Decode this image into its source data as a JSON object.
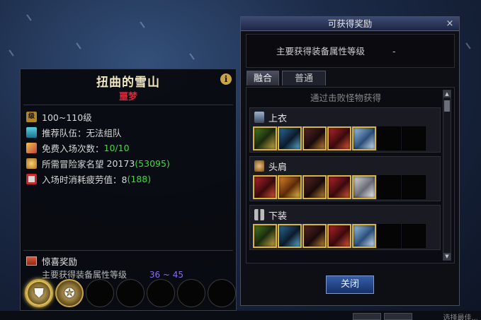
{
  "dungeon": {
    "name": "扭曲的雪山",
    "difficulty": "噩梦",
    "info_icon": "info-icon",
    "stats": [
      {
        "icon": "level-icon",
        "icon_text": "级",
        "text": "100~110级"
      },
      {
        "icon": "party-icon",
        "text": "推荐队伍：无法组队"
      },
      {
        "icon": "ticket-icon",
        "text": "免费入场次数：",
        "value": "10/10"
      },
      {
        "icon": "fame-icon",
        "text": "所需冒险家名望",
        "value": "20173",
        "value_extra": "(53095)"
      },
      {
        "icon": "fatigue-icon",
        "text": "入场时消耗疲劳值：8",
        "value_extra": "(188)"
      }
    ],
    "surprise": {
      "title": "惊喜奖励",
      "subtitle": "主要获得装备属性等级",
      "range": "36 ~ 45"
    }
  },
  "reward_window": {
    "title": "可获得奖励",
    "close_glyph": "×",
    "header_label": "主要获得装备属性等级",
    "header_value": "-",
    "tabs": [
      "融合",
      "普通"
    ],
    "active_tab": "融合",
    "caption": "通过击败怪物获得",
    "groups": [
      {
        "title": "上衣",
        "icon": "top-armor-icon",
        "items": [
          "green",
          "blue",
          "dark",
          "red",
          "lblue"
        ]
      },
      {
        "title": "头肩",
        "icon": "shoulder-armor-icon",
        "items": [
          "red",
          "orange",
          "dark",
          "red",
          "silver"
        ]
      },
      {
        "title": "下装",
        "icon": "pants-armor-icon",
        "items": [
          "green",
          "blue",
          "dark",
          "red",
          "lblue"
        ]
      }
    ],
    "close_button": "关闭"
  },
  "bottom_bar": {
    "text": "选择最佳..."
  }
}
